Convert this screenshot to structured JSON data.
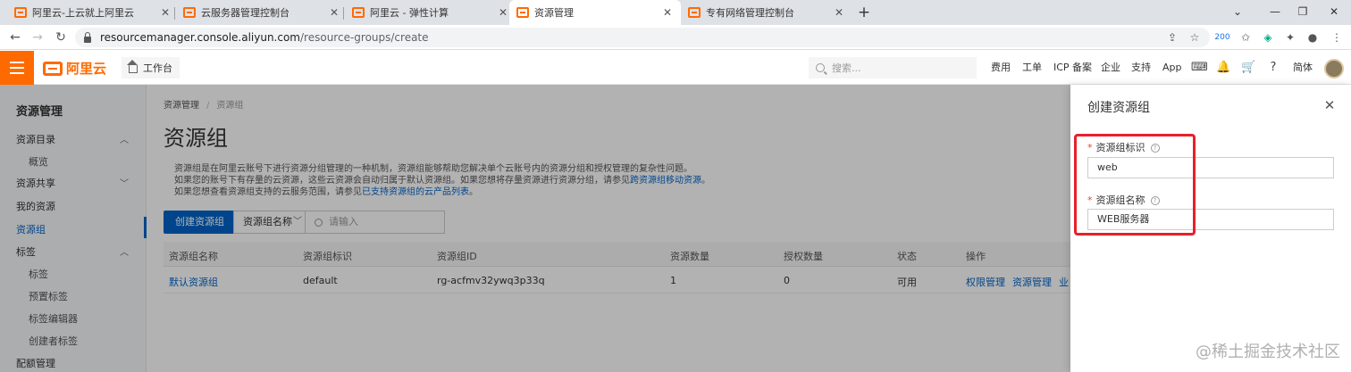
{
  "browser": {
    "tabs": [
      {
        "label": "阿里云-上云就上阿里云",
        "active": false
      },
      {
        "label": "云服务器管理控制台",
        "active": false
      },
      {
        "label": "阿里云 - 弹性计算",
        "active": false
      },
      {
        "label": "资源管理",
        "active": true
      },
      {
        "label": "专有网络管理控制台",
        "active": false
      }
    ],
    "url_host": "resourcemanager.console.aliyun.com",
    "url_path": "/resource-groups/create",
    "ext_badge": "200"
  },
  "topbar": {
    "logo_text": "阿里云",
    "workbench_label": "工作台",
    "search_placeholder": "搜索...",
    "nav": [
      "费用",
      "工单",
      "ICP 备案",
      "企业",
      "支持",
      "App"
    ],
    "lang": "简体"
  },
  "sidebar": {
    "title": "资源管理",
    "items": [
      {
        "label": "资源目录",
        "sub": false,
        "expandable": true
      },
      {
        "label": "概览",
        "sub": true
      },
      {
        "label": "资源共享",
        "sub": false,
        "expandable": true
      },
      {
        "label": "我的资源",
        "sub": false
      },
      {
        "label": "资源组",
        "sub": false,
        "active": true
      },
      {
        "label": "标签",
        "sub": false,
        "expandable": true
      },
      {
        "label": "标签",
        "sub": true
      },
      {
        "label": "预置标签",
        "sub": true
      },
      {
        "label": "标签编辑器",
        "sub": true
      },
      {
        "label": "创建者标签",
        "sub": true
      },
      {
        "label": "配额管理",
        "sub": false
      }
    ]
  },
  "main": {
    "breadcrumb": [
      "资源管理",
      "资源组"
    ],
    "title": "资源组",
    "desc": {
      "line1": "资源组是在阿里云账号下进行资源分组管理的一种机制，资源组能够帮助您解决单个云账号内的资源分组和授权管理的复杂性问题。",
      "line2_a": "如果您的账号下有存量的云资源，这些云资源会自动归属于默认资源组。如果您想将存量资源进行资源分组，请参见",
      "line2_link": "跨资源组移动资源",
      "line2_b": "。",
      "line3_a": "如果您想查看资源组支持的云服务范围，请参见",
      "line3_link": "已支持资源组的云产品列表",
      "line3_b": "。"
    },
    "create_button": "创建资源组",
    "filter_select": "资源组名称",
    "filter_placeholder": "请输入",
    "columns": [
      "资源组名称",
      "资源组标识",
      "资源组ID",
      "资源数量",
      "授权数量",
      "状态",
      "操作"
    ],
    "rows": [
      {
        "name": "默认资源组",
        "key": "default",
        "id": "rg-acfmv32ywq3p33q",
        "resources": "1",
        "grants": "0",
        "status": "可用",
        "actions": [
          "权限管理",
          "资源管理",
          "业"
        ]
      }
    ]
  },
  "drawer": {
    "title": "创建资源组",
    "fields": [
      {
        "label": "资源组标识",
        "value": "web"
      },
      {
        "label": "资源组名称",
        "value": "WEB服务器"
      }
    ]
  },
  "watermark": "@稀土掘金技术社区",
  "colors": {
    "accent": "#ff6a00",
    "link": "#0064c8",
    "highlight": "#e8202a"
  }
}
